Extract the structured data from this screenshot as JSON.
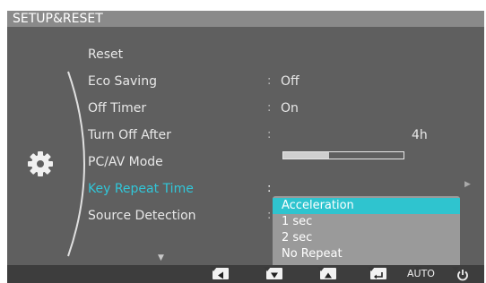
{
  "window": {
    "title": "SETUP&RESET"
  },
  "menu": {
    "items": [
      {
        "label": "Reset"
      },
      {
        "label": "Eco Saving",
        "value": "Off"
      },
      {
        "label": "Off Timer",
        "value": "On"
      },
      {
        "label": "Turn Off After",
        "value": "4h",
        "level_percent": 38
      },
      {
        "label": "PC/AV Mode"
      },
      {
        "label": "Key Repeat Time"
      },
      {
        "label": "Source Detection"
      }
    ],
    "separator": ":",
    "active_index": 5
  },
  "dropdown": {
    "options": [
      "Acceleration",
      "1 sec",
      "2 sec",
      "No Repeat"
    ],
    "selected": "Acceleration"
  },
  "footer": {
    "buttons": [
      {
        "icon": "left-arrow-icon"
      },
      {
        "icon": "down-arrow-icon"
      },
      {
        "icon": "up-arrow-icon"
      },
      {
        "icon": "enter-icon"
      },
      {
        "label": "AUTO"
      },
      {
        "icon": "power-icon"
      }
    ]
  },
  "colors": {
    "active": "#31c6d8",
    "highlight": "#2fc4cf",
    "panel": "#5f5f5f",
    "titlebar": "#8a8a8a"
  }
}
